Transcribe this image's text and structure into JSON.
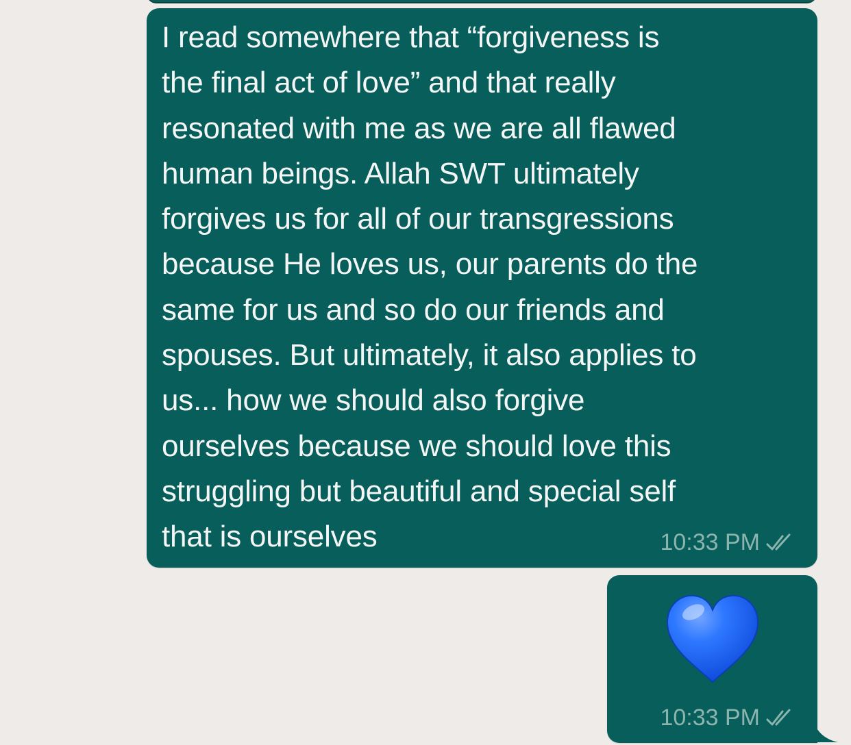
{
  "chat": {
    "messages": [
      {
        "type": "text",
        "text": "I read somewhere that “forgiveness is\nthe final act of love” and that really\nresonated with me as we are all flawed\nhuman beings. Allah SWT ultimately\nforgives us for all of our transgressions\nbecause He loves us, our parents do the\nsame for us and so do our friends and\nspouses. But ultimately, it also applies to\nus... how we should also forgive\nourselves because we should love this\nstruggling but beautiful and special self\nthat is ourselves",
        "time": "10:33 PM",
        "status_icon": "double-check-icon"
      },
      {
        "type": "emoji",
        "emoji_name": "blue-heart",
        "time": "10:33 PM",
        "status_icon": "double-check-icon"
      }
    ]
  },
  "colors": {
    "background": "#efebe8",
    "outgoing_bubble": "#075e5a",
    "message_text": "#f3f6f5",
    "meta_text": "#8db5b0",
    "heart": "#1564ff"
  }
}
